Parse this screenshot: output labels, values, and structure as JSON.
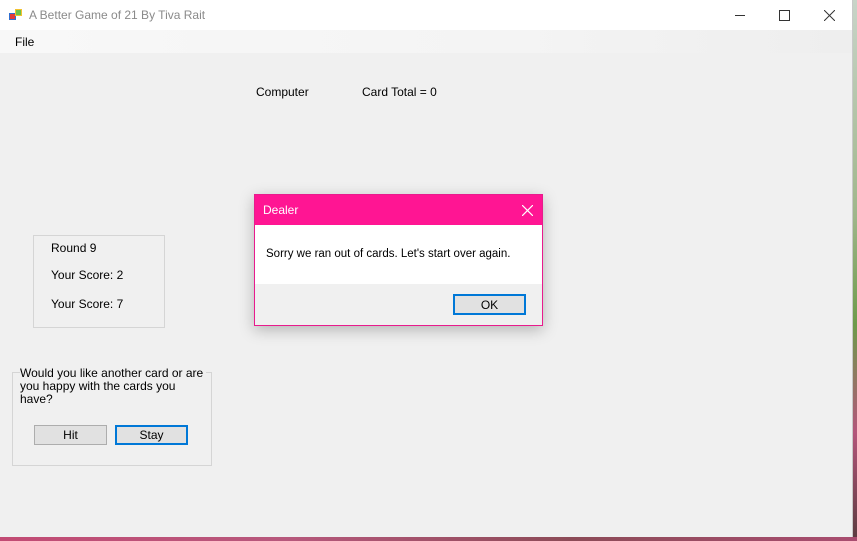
{
  "window": {
    "title": "A Better Game of 21 By Tiva Rait",
    "icons": {
      "app": "app-icon",
      "minimize": "minimize-icon",
      "maximize": "maximize-icon",
      "close": "close-icon"
    }
  },
  "menu": {
    "file_label": "File"
  },
  "header": {
    "computer_label": "Computer",
    "card_total_label": "Card Total = 0"
  },
  "scoreboard": {
    "round_label": "Round 9",
    "score_1_label": "Your Score: 2",
    "score_2_label": "Your Score: 7"
  },
  "prompt": {
    "question": "Would you like another card or are you happy with the cards you have?",
    "hit_label": "Hit",
    "stay_label": "Stay"
  },
  "dialog": {
    "title": "Dealer",
    "message": "Sorry we ran out of cards. Let's start over again.",
    "ok_label": "OK",
    "accent_color": "#ff1593"
  }
}
